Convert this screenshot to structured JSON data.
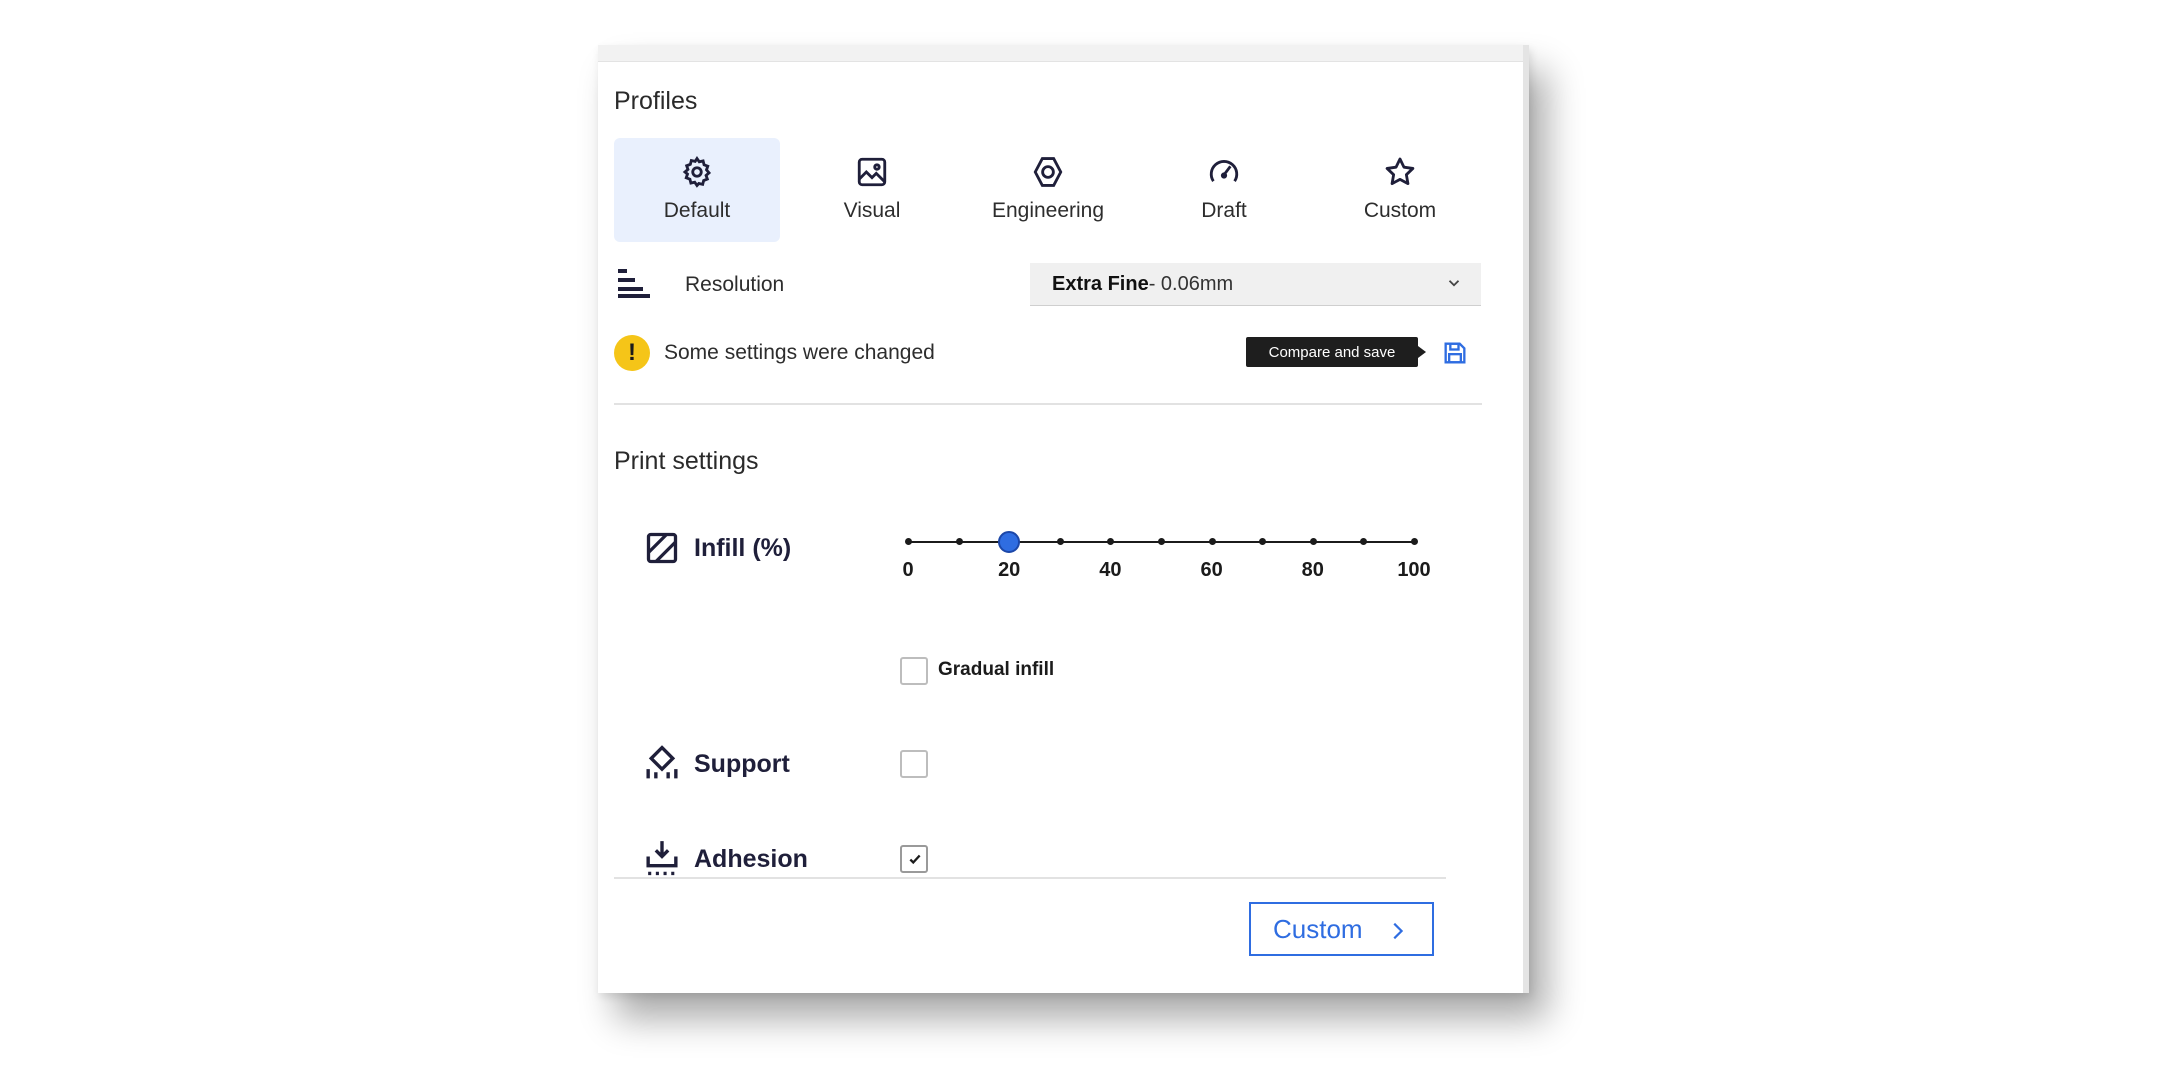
{
  "profiles": {
    "title": "Profiles",
    "tabs": [
      {
        "label": "Default",
        "icon": "gear-icon",
        "active": true
      },
      {
        "label": "Visual",
        "icon": "image-icon"
      },
      {
        "label": "Engineering",
        "icon": "hex-nut-icon"
      },
      {
        "label": "Draft",
        "icon": "speedometer-icon"
      },
      {
        "label": "Custom",
        "icon": "star-icon"
      }
    ]
  },
  "resolution": {
    "label": "Resolution",
    "value_bold": "Extra Fine",
    "value_rest": " - 0.06mm"
  },
  "warning": {
    "text": "Some settings were changed",
    "tooltip": "Compare and save"
  },
  "print_settings": {
    "title": "Print settings",
    "infill": {
      "label": "Infill (%)",
      "value": 20,
      "ticks": [
        "0",
        "20",
        "40",
        "60",
        "80",
        "100"
      ],
      "gradual_label": "Gradual infill",
      "gradual_checked": false
    },
    "support": {
      "label": "Support",
      "checked": false
    },
    "adhesion": {
      "label": "Adhesion",
      "checked": true
    }
  },
  "footer": {
    "custom_button": "Custom"
  },
  "colors": {
    "accent": "#2f6de1",
    "warning": "#f5c518",
    "active_tab_bg": "#e9f0fd"
  }
}
